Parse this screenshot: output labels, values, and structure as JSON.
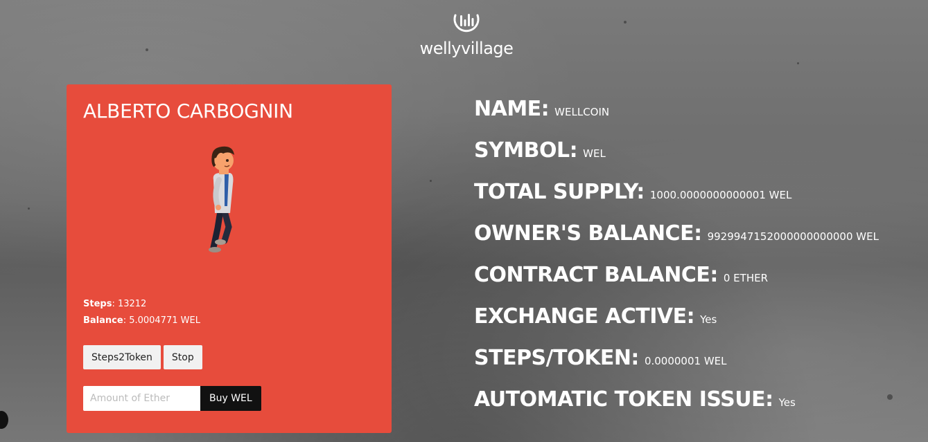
{
  "logo": {
    "text": "wellyvillage",
    "icon": "bars-in-circle-icon"
  },
  "card": {
    "name": "ALBERTO CARBOGNIN",
    "avatar": "walking-man-avatar",
    "steps_label": "Steps",
    "steps_value": ": 13212",
    "balance_label": "Balance",
    "balance_value": ": 5.0004771 WEL",
    "steps2token_label": "Steps2Token",
    "stop_label": "Stop",
    "ether_placeholder": "Amount of Ether",
    "buy_label": "Buy WEL",
    "color": "#e74c3c"
  },
  "info": [
    {
      "label": "NAME:",
      "value": "WELLCOIN"
    },
    {
      "label": "SYMBOL:",
      "value": "WEL"
    },
    {
      "label": "TOTAL SUPPLY:",
      "value": "1000.0000000000001 WEL"
    },
    {
      "label": "OWNER'S BALANCE:",
      "value": "9929947152000000000000 WEL"
    },
    {
      "label": "CONTRACT BALANCE:",
      "value": "0 ETHER"
    },
    {
      "label": "EXCHANGE ACTIVE:",
      "value": "Yes"
    },
    {
      "label": "STEPS/TOKEN:",
      "value": "0.0000001 WEL"
    },
    {
      "label": "AUTOMATIC TOKEN ISSUE:",
      "value": "Yes"
    }
  ]
}
